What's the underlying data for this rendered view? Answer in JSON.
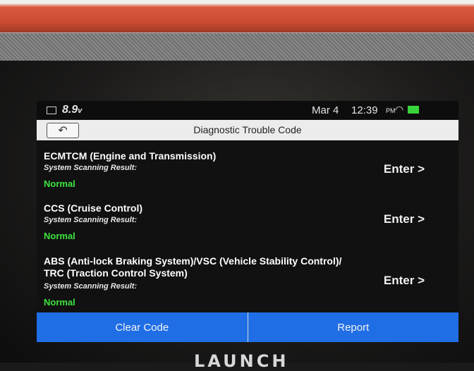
{
  "device": {
    "brand": "LAUNCH"
  },
  "statusbar": {
    "voltage": "8.9",
    "voltage_unit": "v",
    "date": "Mar 4",
    "time": "12:39",
    "ampm": "PM",
    "battery_color": "#39d33b"
  },
  "header": {
    "title": "Diagnostic Trouble Code",
    "back_icon": "back-arrow-icon"
  },
  "systems": [
    {
      "name": "ECMTCM (Engine and Transmission)",
      "scan_label": "System Scanning Result:",
      "status": "Normal",
      "enter_label": "Enter >"
    },
    {
      "name": "CCS (Cruise Control)",
      "scan_label": "System Scanning Result:",
      "status": "Normal",
      "enter_label": "Enter >"
    },
    {
      "name_line1": "ABS (Anti-lock Braking System)/VSC (Vehicle Stability Control)/",
      "name_line2": "TRC (Traction Control System)",
      "scan_label": "System Scanning Result:",
      "status": "Normal",
      "enter_label": "Enter >"
    }
  ],
  "footer": {
    "clear_label": "Clear Code",
    "report_label": "Report",
    "accent": "#1f6ee6"
  },
  "colors": {
    "status_normal": "#3de33f"
  }
}
